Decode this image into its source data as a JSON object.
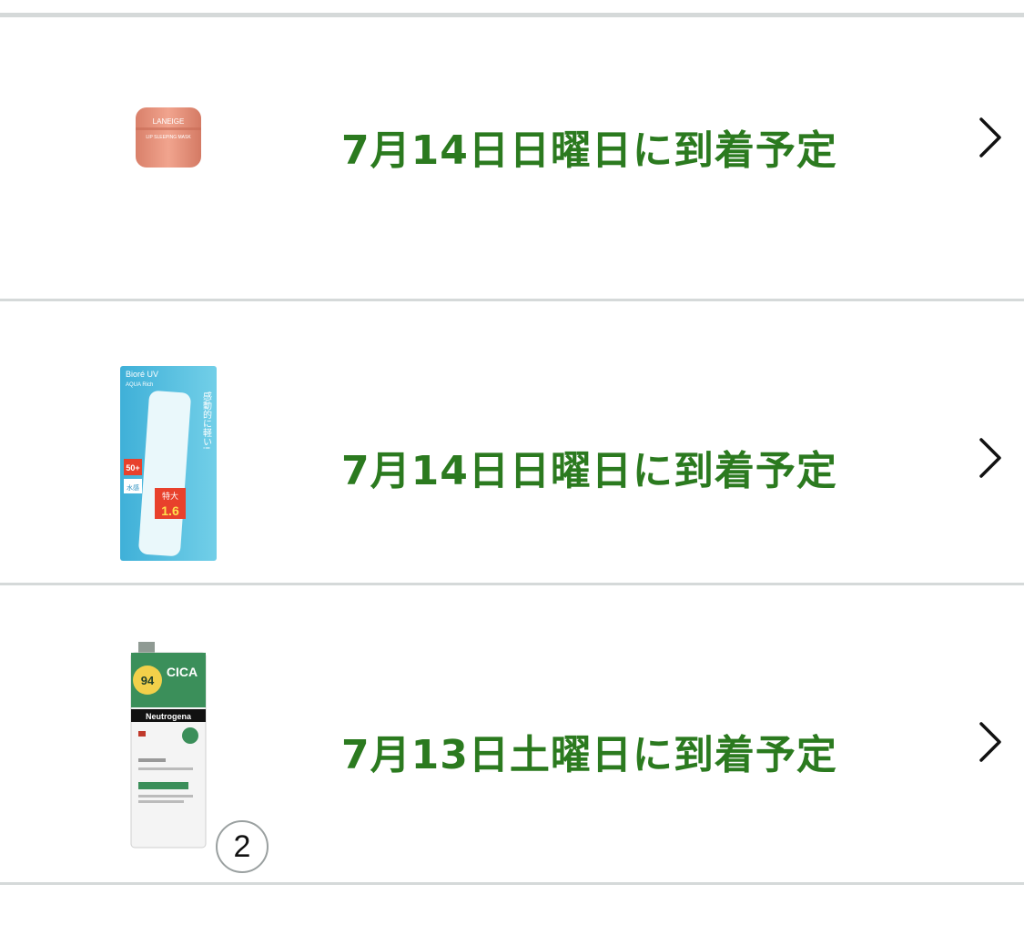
{
  "deliveries": [
    {
      "status": "7月14日日曜日に到着予定",
      "product_icon": "laneige-lip-mask-jar",
      "product_text": [
        "LANEIGE",
        "LIP SLEEPING MASK"
      ]
    },
    {
      "status": "7月14日日曜日に到着予定",
      "product_icon": "biore-uv-aqua-rich-tube",
      "product_text": [
        "Bioré UV",
        "AQUA Rich",
        "感動的に軽い!",
        "50+",
        "特大",
        "1.6",
        "水感"
      ]
    },
    {
      "status": "7月13日土曜日に到着予定",
      "product_icon": "neutrogena-cica-bottle",
      "product_text": [
        "94",
        "CICA",
        "Neutrogena"
      ],
      "quantity_badge": "2"
    }
  ],
  "icons": {
    "chevron": "chevron-right-icon"
  },
  "colors": {
    "status_text": "#2b7a1f",
    "divider": "#d5d9d9",
    "chevron": "#111111"
  }
}
